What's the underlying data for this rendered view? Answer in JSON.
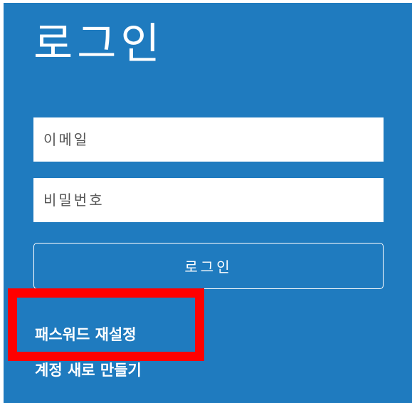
{
  "login": {
    "title": "로그인",
    "email": {
      "placeholder": "이메일",
      "value": ""
    },
    "password": {
      "placeholder": "비밀번호",
      "value": ""
    },
    "submit_label": "로그인",
    "reset_password_link": "패스워드 재설정",
    "create_account_link": "계정 새로 만들기"
  },
  "colors": {
    "panel_background": "#1f7bbf",
    "highlight_box": "#ff0000",
    "text": "#ffffff",
    "input_background": "#ffffff"
  }
}
